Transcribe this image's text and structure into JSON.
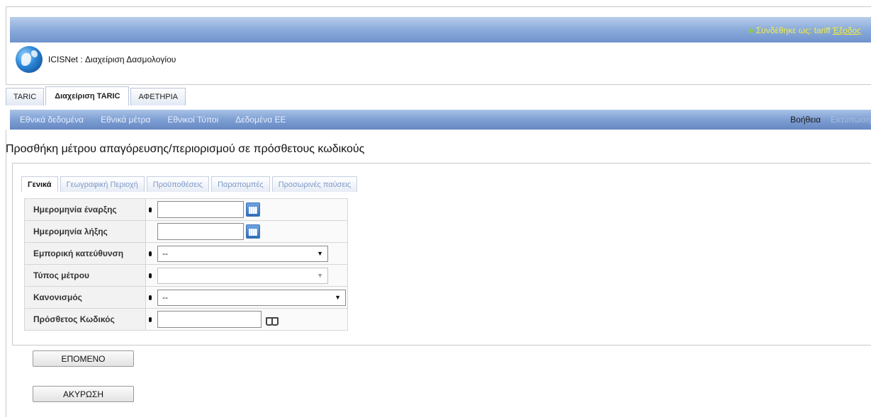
{
  "header": {
    "logged_in_as": "Συνδέθηκε ως: tariff",
    "logout": "Έξοδος",
    "app_title": "ICISNet : Διαχείριση Δασμολογίου"
  },
  "main_tabs": [
    {
      "label": "TARIC",
      "active": false
    },
    {
      "label": "Διαχείριση TARIC",
      "active": true
    },
    {
      "label": "ΑΦΕΤΗΡΙΑ",
      "active": false
    }
  ],
  "nav": {
    "items": [
      "Εθνικά δεδομένα",
      "Εθνικά μέτρα",
      "Εθνικοί Τύποι",
      "Δεδομένα ΕΕ"
    ],
    "help": "Βοήθεια",
    "print": "Εκτύπωση"
  },
  "page_heading": "Προσθήκη μέτρου απαγόρευσης/περιορισμού σε πρόσθετους κωδικούς",
  "sub_tabs": [
    {
      "label": "Γενικά",
      "active": true
    },
    {
      "label": "Γεωγραφική Περιοχή",
      "active": false
    },
    {
      "label": "Προϋποθέσεις",
      "active": false
    },
    {
      "label": "Παραπομπές",
      "active": false
    },
    {
      "label": "Προσωρινές παύσεις",
      "active": false
    }
  ],
  "form": {
    "start_date": {
      "label": "Ημερομηνία έναρξης",
      "value": ""
    },
    "end_date": {
      "label": "Ημερομηνία λήξης",
      "value": ""
    },
    "trade_direction": {
      "label": "Εμπορική κατεύθυνση",
      "value": "--"
    },
    "measure_type": {
      "label": "Τύπος μέτρου",
      "value": ""
    },
    "regulation": {
      "label": "Κανονισμός",
      "value": "--"
    },
    "additional_code": {
      "label": "Πρόσθετος Κωδικός",
      "value": ""
    }
  },
  "buttons": {
    "next": "ΕΠΟΜΕΝΟ",
    "cancel": "ΑΚΥΡΩΣΗ"
  },
  "colors": {
    "header_bar": "#7e9fd3",
    "user_text": "#f4ef3a",
    "tab_inactive_text": "#7f99c6"
  }
}
